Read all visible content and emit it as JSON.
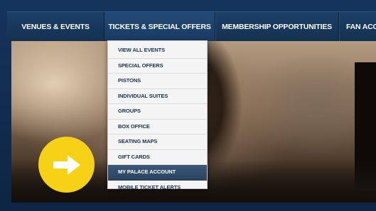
{
  "nav": {
    "items": [
      {
        "label": "VENUES & EVENTS"
      },
      {
        "label": "TICKETS & SPECIAL OFFERS"
      },
      {
        "label": "MEMBERSHIP OPPORTUNITIES"
      },
      {
        "label": "FAN ACC"
      }
    ]
  },
  "dropdown": {
    "items": [
      {
        "label": "VIEW ALL EVENTS"
      },
      {
        "label": "SPECIAL OFFERS"
      },
      {
        "label": "PISTONS"
      },
      {
        "label": "INDIVIDUAL SUITES"
      },
      {
        "label": "GROUPS"
      },
      {
        "label": "BOX OFFICE"
      },
      {
        "label": "SEATING MAPS"
      },
      {
        "label": "GIFT CARDS"
      },
      {
        "label": "MY PALACE ACCOUNT"
      },
      {
        "label": "MOBILE TICKET ALERTS"
      }
    ],
    "highlighted_index": 8
  },
  "hero": {
    "arrow_icon": "right-arrow-icon",
    "arrow_color": "#f7d116"
  },
  "colors": {
    "nav_background": "#1a3a60",
    "dropdown_background": "#f4f4f4",
    "dropdown_text": "#17304f",
    "highlight": "#2f4a6b"
  }
}
